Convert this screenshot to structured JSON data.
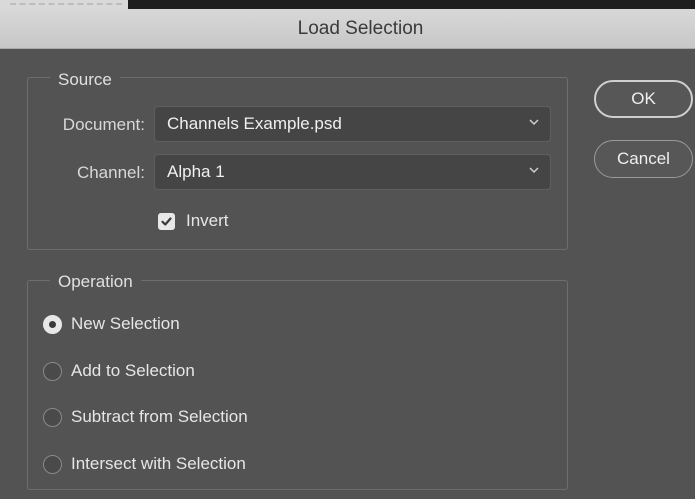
{
  "dialog": {
    "title": "Load Selection"
  },
  "source": {
    "legend": "Source",
    "document_label": "Document:",
    "document_value": "Channels Example.psd",
    "channel_label": "Channel:",
    "channel_value": "Alpha 1",
    "invert_label": "Invert",
    "invert_checked": true
  },
  "operation": {
    "legend": "Operation",
    "options": [
      {
        "label": "New Selection",
        "selected": true
      },
      {
        "label": "Add to Selection",
        "selected": false
      },
      {
        "label": "Subtract from Selection",
        "selected": false
      },
      {
        "label": "Intersect with Selection",
        "selected": false
      }
    ]
  },
  "buttons": {
    "ok": "OK",
    "cancel": "Cancel"
  },
  "icons": {
    "dropdown": "chevron-down-icon",
    "check": "checkmark-icon"
  }
}
